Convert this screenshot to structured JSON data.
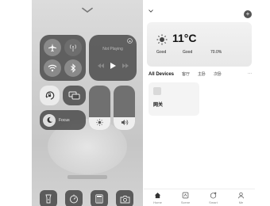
{
  "control_center": {
    "media": {
      "label": "Not Playing"
    },
    "focus": {
      "label": "Focus"
    },
    "brightness_level": 0.28,
    "volume_level": 0.28,
    "connectivity": [
      {
        "name": "airplane-mode",
        "icon": "airplane-icon",
        "active": true
      },
      {
        "name": "cellular-data",
        "icon": "antenna-icon",
        "active": false
      },
      {
        "name": "wifi",
        "icon": "wifi-icon",
        "active": true
      },
      {
        "name": "bluetooth",
        "icon": "bluetooth-icon",
        "active": true
      }
    ],
    "dock": [
      {
        "icon": "flashlight-icon"
      },
      {
        "icon": "timer-icon"
      },
      {
        "icon": "calculator-icon"
      },
      {
        "icon": "camera-icon"
      }
    ]
  },
  "app": {
    "weather": {
      "temperature": "11°C",
      "icon": "sun-icon",
      "stats": [
        {
          "value": "Good"
        },
        {
          "value": "Good"
        },
        {
          "value": "70.0%"
        }
      ]
    },
    "tabs": [
      "All Devices",
      "客厅",
      "主卧",
      "次卧"
    ],
    "tab_more": "···",
    "devices": [
      {
        "name": "网关",
        "icon": "gateway-icon"
      }
    ],
    "nav": [
      {
        "label": "Home",
        "icon": "home-icon"
      },
      {
        "label": "Scene",
        "icon": "scene-icon"
      },
      {
        "label": "Smart",
        "icon": "smart-icon"
      },
      {
        "label": "Me",
        "icon": "profile-icon"
      }
    ]
  }
}
